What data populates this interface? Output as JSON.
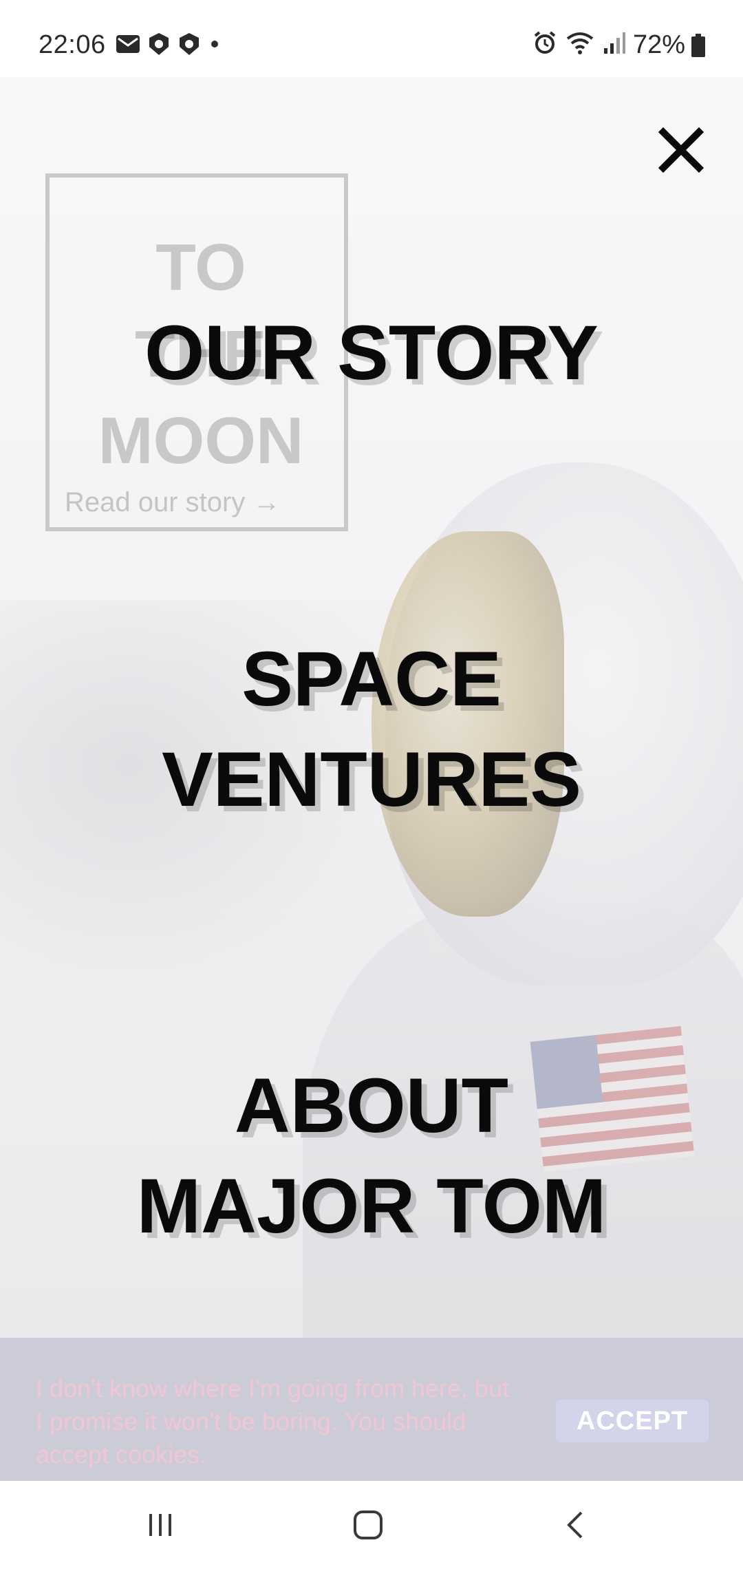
{
  "status_bar": {
    "time": "22:06",
    "left_icons": [
      "mail-icon",
      "shield-icon",
      "shield-icon",
      "dot-icon"
    ],
    "right_icons": [
      "alarm-icon",
      "wifi-icon",
      "signal-icon"
    ],
    "battery_percent": "72%"
  },
  "hero_card": {
    "title": "TO\nTHE\nMOON",
    "link": "Read our story →"
  },
  "menu": {
    "items": [
      {
        "label": "OUR STORY"
      },
      {
        "label": "SPACE\nVENTURES"
      },
      {
        "label": "ABOUT\nMAJOR TOM"
      }
    ]
  },
  "cookie": {
    "message": "I don't know where I'm going from here, but I promise it won't be boring. You should accept cookies.",
    "accept_label": "ACCEPT"
  },
  "colors": {
    "menu_text": "#0a0a0a",
    "cookie_bg": "#cbccd7",
    "cookie_text": "#f2c6d4",
    "accept_bg": "#d3d4ea"
  }
}
